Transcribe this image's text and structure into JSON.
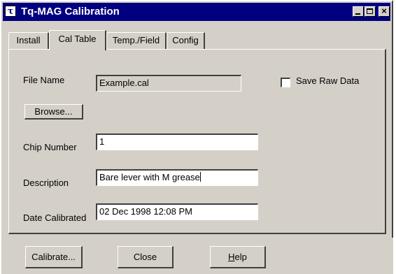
{
  "window": {
    "title": "Tq-MAG Calibration",
    "icon_glyph": "τ",
    "close_glyph": "×"
  },
  "tabs": [
    {
      "label": "Install",
      "active": false
    },
    {
      "label": "Cal Table",
      "active": true
    },
    {
      "label": "Temp./Field",
      "active": false
    },
    {
      "label": "Config",
      "active": false
    }
  ],
  "form": {
    "file_name_label": "File Name",
    "file_name_value": "Example.cal",
    "browse_label": "Browse...",
    "save_raw_label": "Save Raw Data",
    "save_raw_checked": false,
    "chip_number_label": "Chip Number",
    "chip_number_value": "1",
    "description_label": "Description",
    "description_value": "Bare lever with M grease",
    "date_label": "Date Calibrated",
    "date_value": "02 Dec 1998 12:08 PM"
  },
  "buttons": {
    "calibrate_label": "Calibrate...",
    "close_label": "Close",
    "help_label": "Help",
    "help_mnemonic": "H",
    "help_rest": "elp"
  },
  "colors": {
    "titlebar": "#000080",
    "face": "#d4d0c8"
  }
}
